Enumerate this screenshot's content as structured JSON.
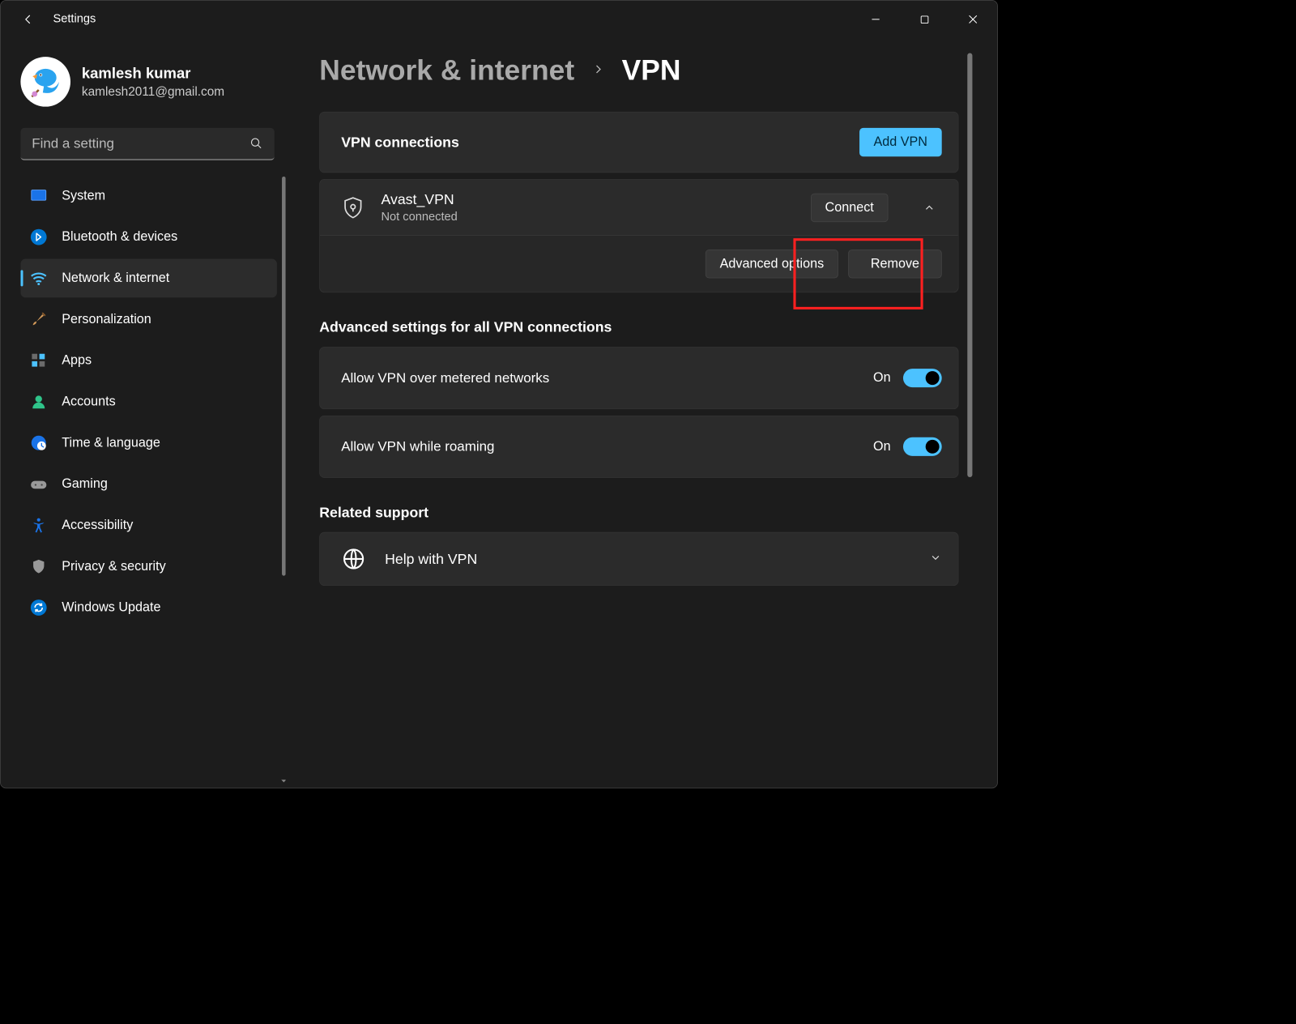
{
  "window": {
    "title": "Settings"
  },
  "profile": {
    "name": "kamlesh kumar",
    "email": "kamlesh2011@gmail.com"
  },
  "search": {
    "placeholder": "Find a setting"
  },
  "nav": {
    "items": [
      {
        "label": "System"
      },
      {
        "label": "Bluetooth & devices"
      },
      {
        "label": "Network & internet"
      },
      {
        "label": "Personalization"
      },
      {
        "label": "Apps"
      },
      {
        "label": "Accounts"
      },
      {
        "label": "Time & language"
      },
      {
        "label": "Gaming"
      },
      {
        "label": "Accessibility"
      },
      {
        "label": "Privacy & security"
      },
      {
        "label": "Windows Update"
      }
    ],
    "active_index": 2
  },
  "breadcrumb": {
    "parent": "Network & internet",
    "current": "VPN"
  },
  "vpn_connections": {
    "heading": "VPN connections",
    "add_button": "Add VPN",
    "items": [
      {
        "name": "Avast_VPN",
        "status": "Not connected",
        "connect_label": "Connect",
        "advanced_label": "Advanced options",
        "remove_label": "Remove",
        "expanded": true
      }
    ]
  },
  "advanced": {
    "heading": "Advanced settings for all VPN connections",
    "rows": [
      {
        "label": "Allow VPN over metered networks",
        "state": "On",
        "on": true
      },
      {
        "label": "Allow VPN while roaming",
        "state": "On",
        "on": true
      }
    ]
  },
  "related": {
    "heading": "Related support",
    "help_label": "Help with VPN"
  }
}
